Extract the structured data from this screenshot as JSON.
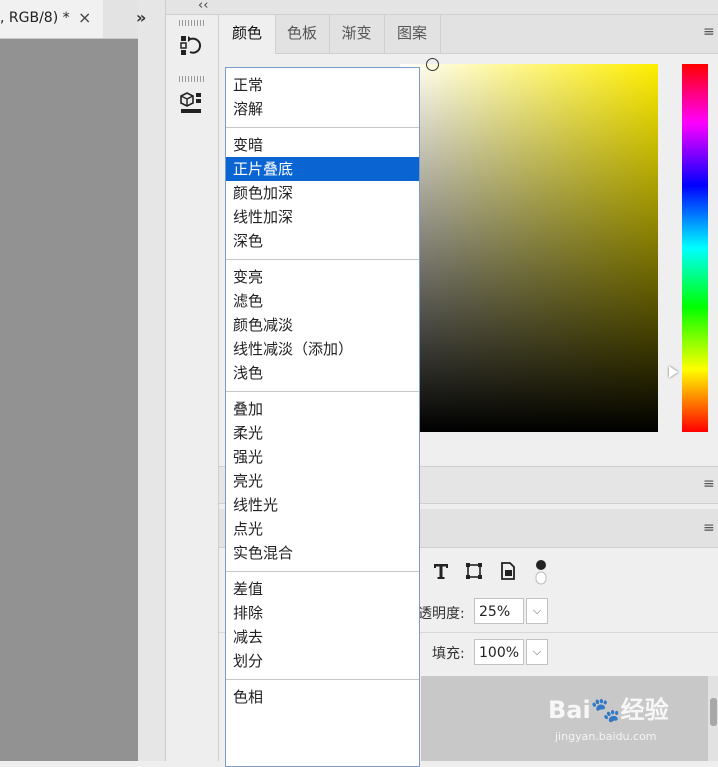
{
  "document_tab": {
    "label": ", RGB/8) *",
    "close_icon": "×"
  },
  "expand_panels_glyph": "»",
  "collapse_panels_glyph": "‹‹",
  "color_panel": {
    "tabs": [
      "颜色",
      "色板",
      "渐变",
      "图案"
    ],
    "active_tab": "颜色",
    "menu_icon": "≡",
    "base_hue_color": "#ffee00"
  },
  "blend_mode_menu": {
    "selected": "正片叠底",
    "groups": [
      [
        "正常",
        "溶解"
      ],
      [
        "变暗",
        "正片叠底",
        "颜色加深",
        "线性加深",
        "深色"
      ],
      [
        "变亮",
        "滤色",
        "颜色减淡",
        "线性减淡（添加）",
        "浅色"
      ],
      [
        "叠加",
        "柔光",
        "强光",
        "亮光",
        "线性光",
        "点光",
        "实色混合"
      ],
      [
        "差值",
        "排除",
        "减去",
        "划分"
      ],
      [
        "色相"
      ]
    ]
  },
  "layers_panel": {
    "opacity_label": "透明度:",
    "opacity_value": "25%",
    "fill_label": "填充:",
    "fill_value": "100%",
    "dropdown_icon": "⌵",
    "menu_icon": "≡"
  },
  "watermark": {
    "logo": "Bai🐾经验",
    "url": "jingyan.baidu.com"
  },
  "colors": {
    "selection": "#0a64d2",
    "canvas_bg": "#929292"
  }
}
